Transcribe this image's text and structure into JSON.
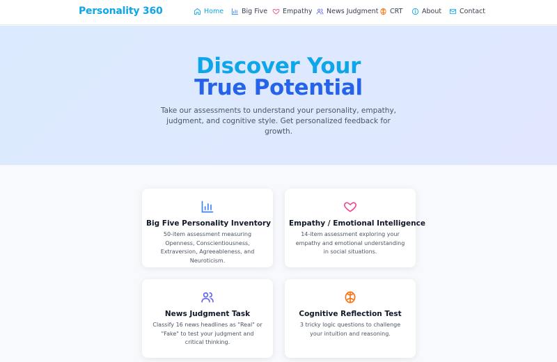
{
  "brand": {
    "name": "Personality 360"
  },
  "nav": {
    "items": [
      {
        "label": "Home",
        "icon": "home-icon",
        "active": true
      },
      {
        "label": "Big Five",
        "icon": "bar-chart-icon"
      },
      {
        "label": "Empathy",
        "icon": "heart-icon"
      },
      {
        "label": "News Judgment",
        "icon": "users-icon"
      },
      {
        "label": "CRT",
        "icon": "brain-icon"
      },
      {
        "label": "About",
        "icon": "info-icon"
      },
      {
        "label": "Contact",
        "icon": "mail-icon"
      }
    ]
  },
  "hero": {
    "title_line1": "Discover Your",
    "title_line2": "True Potential",
    "subtitle": "Take our assessments to understand your personality, empathy, judgment, and cognitive style. Get personalized feedback for growth."
  },
  "cards": [
    {
      "title": "Big Five Personality Inventory",
      "description": "50-item assessment measuring Openness, Conscientiousness, Extraversion, Agreeableness, and Neuroticism.",
      "icon": "bar-chart-icon"
    },
    {
      "title": "Empathy / Emotional Intelligence",
      "description": "14-item assessment exploring your empathy and emotional understanding in social situations.",
      "icon": "heart-icon"
    },
    {
      "title": "News Judgment Task",
      "description": "Classify 16 news headlines as \"Real\" or \"Fake\" to test your judgment and critical thinking.",
      "icon": "users-icon"
    },
    {
      "title": "Cognitive Reflection Test",
      "description": "3 tricky logic questions to challenge your intuition and reasoning.",
      "icon": "brain-icon"
    }
  ],
  "colors": {
    "brand": "#0ea5e9",
    "hero_title_2": "#2563eb",
    "big_five_icon": "#3b82f6",
    "empathy_icon": "#ec4899",
    "news_icon": "#6366f1",
    "crt_icon": "#f97316"
  }
}
